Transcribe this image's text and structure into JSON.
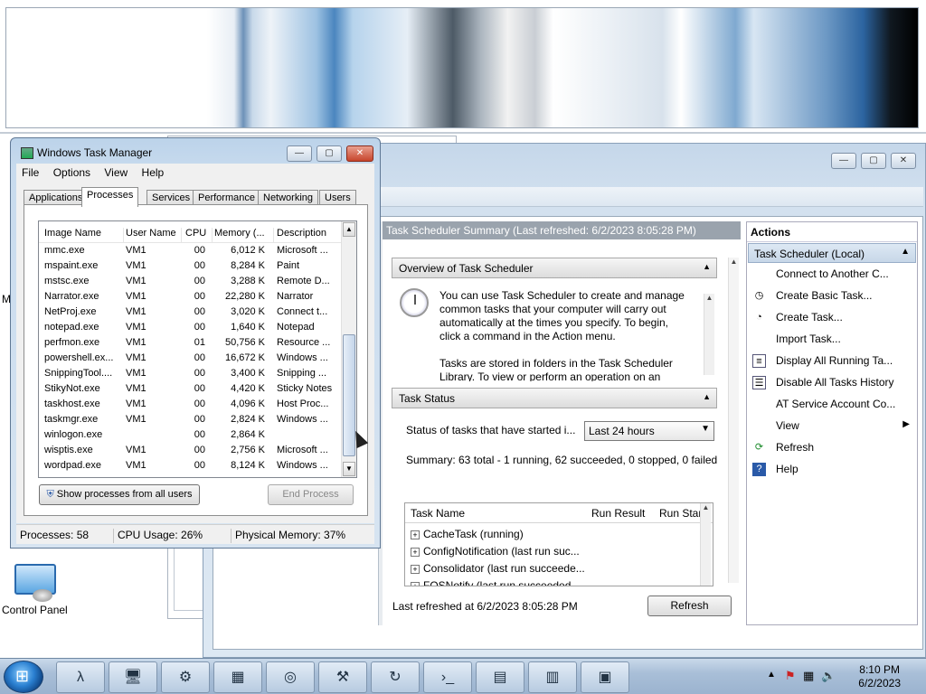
{
  "desktop": {
    "partial_text": "M",
    "control_panel_label": "Control Panel"
  },
  "task_scheduler": {
    "summary_header": "Task Scheduler Summary (Last refreshed: 6/2/2023 8:05:28 PM)",
    "overview_title": "Overview of Task Scheduler",
    "overview_text_1": "You can use Task Scheduler to create and manage",
    "overview_text_2": "common tasks that your computer will carry out",
    "overview_text_3": "automatically at the times you specify. To begin,",
    "overview_text_4": "click a command in the Action menu.",
    "overview_text_5": "Tasks are stored in folders in the Task Scheduler",
    "overview_text_6": "Library. To view or perform an operation on an",
    "status_title": "Task Status",
    "status_label": "Status of tasks that have started i...",
    "status_range": "Last 24 hours",
    "summary_line": "Summary: 63 total - 1 running, 62 succeeded, 0 stopped, 0 failed",
    "col_task_name": "Task Name",
    "col_run_result": "Run Result",
    "col_run_start": "Run Star",
    "tasks": [
      "CacheTask (running)",
      "ConfigNotification (last run suc...",
      "Consolidator (last run succeede...",
      "FOSNotify (last run succeeded"
    ],
    "last_refreshed": "Last refreshed at 6/2/2023 8:05:28 PM",
    "refresh_button": "Refresh",
    "actions_title": "Actions",
    "actions_group": "Task Scheduler (Local)",
    "actions": [
      {
        "label": "Connect to Another C...",
        "icon": ""
      },
      {
        "label": "Create Basic Task...",
        "icon": "clock-icon"
      },
      {
        "label": "Create Task...",
        "icon": "task-icon"
      },
      {
        "label": "Import Task...",
        "icon": ""
      },
      {
        "label": "Display All Running Ta...",
        "icon": "list-icon"
      },
      {
        "label": "Disable All Tasks History",
        "icon": "history-icon"
      },
      {
        "label": "AT Service Account Co...",
        "icon": ""
      },
      {
        "label": "View",
        "icon": ""
      },
      {
        "label": "Refresh",
        "icon": "refresh-icon"
      },
      {
        "label": "Help",
        "icon": "help-icon"
      }
    ]
  },
  "task_manager": {
    "title": "Windows Task Manager",
    "menu": [
      "File",
      "Options",
      "View",
      "Help"
    ],
    "tabs": [
      "Applications",
      "Processes",
      "Services",
      "Performance",
      "Networking",
      "Users"
    ],
    "active_tab": "Processes",
    "columns": [
      "Image Name",
      "User Name",
      "CPU",
      "Memory (...",
      "Description"
    ],
    "processes": [
      [
        "mmc.exe",
        "VM1",
        "00",
        "6,012 K",
        "Microsoft ..."
      ],
      [
        "mspaint.exe",
        "VM1",
        "00",
        "8,284 K",
        "Paint"
      ],
      [
        "mstsc.exe",
        "VM1",
        "00",
        "3,288 K",
        "Remote D..."
      ],
      [
        "Narrator.exe",
        "VM1",
        "00",
        "22,280 K",
        "Narrator"
      ],
      [
        "NetProj.exe",
        "VM1",
        "00",
        "3,020 K",
        "Connect t..."
      ],
      [
        "notepad.exe",
        "VM1",
        "00",
        "1,640 K",
        "Notepad"
      ],
      [
        "perfmon.exe",
        "VM1",
        "01",
        "50,756 K",
        "Resource ..."
      ],
      [
        "powershell.ex...",
        "VM1",
        "00",
        "16,672 K",
        "Windows ..."
      ],
      [
        "SnippingTool....",
        "VM1",
        "00",
        "3,400 K",
        "Snipping ..."
      ],
      [
        "StikyNot.exe",
        "VM1",
        "00",
        "4,420 K",
        "Sticky Notes"
      ],
      [
        "taskhost.exe",
        "VM1",
        "00",
        "4,096 K",
        "Host Proc..."
      ],
      [
        "taskmgr.exe",
        "VM1",
        "00",
        "2,824 K",
        "Windows ..."
      ],
      [
        "winlogon.exe",
        "",
        "00",
        "2,864 K",
        ""
      ],
      [
        "wisptis.exe",
        "VM1",
        "00",
        "2,756 K",
        "Microsoft ..."
      ],
      [
        "wordpad.exe",
        "VM1",
        "00",
        "8,124 K",
        "Windows ..."
      ]
    ],
    "show_all_button": "Show processes from all users",
    "end_process_button": "End Process",
    "status_processes": "Processes: 58",
    "status_cpu": "CPU Usage: 26%",
    "status_memory": "Physical Memory: 37%"
  },
  "taskbar": {
    "time": "8:10 PM",
    "date": "6/2/2023",
    "buttons": [
      "λ",
      "🖥",
      "⚙",
      "▦",
      "◎",
      "⚒",
      "↻",
      "›_",
      "▤",
      "▥",
      "▣"
    ]
  }
}
